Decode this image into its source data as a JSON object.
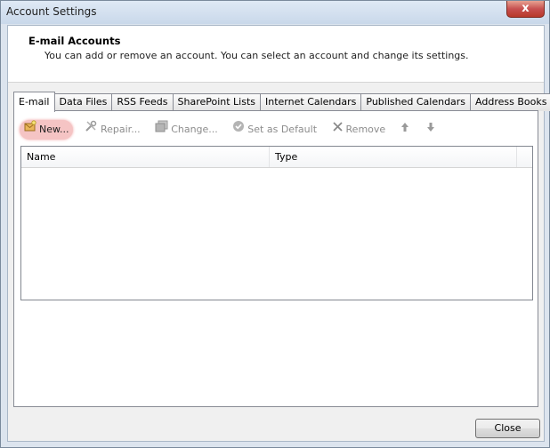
{
  "window": {
    "title": "Account Settings",
    "close_glyph": "x"
  },
  "header": {
    "title": "E-mail Accounts",
    "description": "You can add or remove an account. You can select an account and change its settings."
  },
  "tabs": [
    {
      "label": "E-mail",
      "active": true
    },
    {
      "label": "Data Files"
    },
    {
      "label": "RSS Feeds"
    },
    {
      "label": "SharePoint Lists"
    },
    {
      "label": "Internet Calendars"
    },
    {
      "label": "Published Calendars"
    },
    {
      "label": "Address Books"
    }
  ],
  "toolbar": {
    "new_label": "New...",
    "repair_label": "Repair...",
    "change_label": "Change...",
    "default_label": "Set as Default",
    "remove_label": "Remove"
  },
  "list": {
    "columns": [
      "Name",
      "Type"
    ]
  },
  "footer": {
    "close_label": "Close"
  },
  "colors": {
    "new_highlight": "#f5c4c4",
    "disabled_text": "#8c8c8c"
  }
}
